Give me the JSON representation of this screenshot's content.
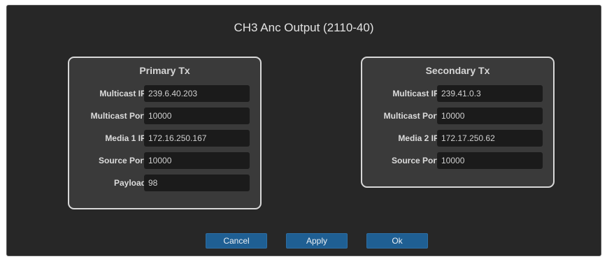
{
  "dialog": {
    "title": "CH3 Anc Output (2110-40)"
  },
  "primary": {
    "title": "Primary Tx",
    "fields": [
      {
        "label": "Multicast IP",
        "value": "239.6.40.203"
      },
      {
        "label": "Multicast Port",
        "value": "10000"
      },
      {
        "label": "Media 1 IP",
        "value": "172.16.250.167"
      },
      {
        "label": "Source Port",
        "value": "10000"
      },
      {
        "label": "Payload",
        "value": "98"
      }
    ]
  },
  "secondary": {
    "title": "Secondary Tx",
    "fields": [
      {
        "label": "Multicast IP",
        "value": "239.41.0.3"
      },
      {
        "label": "Multicast Port",
        "value": "10000"
      },
      {
        "label": "Media 2 IP",
        "value": "172.17.250.62"
      },
      {
        "label": "Source Port",
        "value": "10000"
      }
    ]
  },
  "buttons": {
    "cancel": "Cancel",
    "apply": "Apply",
    "ok": "Ok"
  }
}
